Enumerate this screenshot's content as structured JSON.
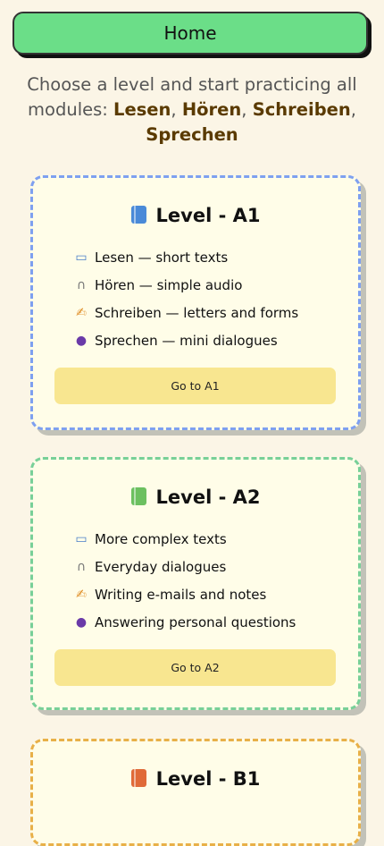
{
  "header": {
    "home_label": "Home"
  },
  "intro": {
    "prefix": "Choose a level and start practicing all modules: ",
    "modules": [
      "Lesen",
      "Hören",
      "Schreiben",
      "Sprechen"
    ],
    "sep1": ", ",
    "sep2": ", ",
    "sep3": ", "
  },
  "levels": [
    {
      "title": "Level - A1",
      "icon": "blue-book-icon",
      "color": "#7ea0f0",
      "items": [
        {
          "icon": "open-book-icon",
          "text": "Lesen — short texts"
        },
        {
          "icon": "headphones-icon",
          "text": "Hören — simple audio"
        },
        {
          "icon": "writing-hand-icon",
          "text": "Schreiben — letters and forms"
        },
        {
          "icon": "speaking-head-icon",
          "text": "Sprechen — mini dialogues"
        }
      ],
      "button": "Go to A1"
    },
    {
      "title": "Level - A2",
      "icon": "green-book-icon",
      "color": "#78d098",
      "items": [
        {
          "icon": "open-book-icon",
          "text": "More complex texts"
        },
        {
          "icon": "headphones-icon",
          "text": "Everyday dialogues"
        },
        {
          "icon": "writing-hand-icon",
          "text": "Writing e-mails and notes"
        },
        {
          "icon": "speaking-head-icon",
          "text": "Answering personal questions"
        }
      ],
      "button": "Go to A2"
    },
    {
      "title": "Level - B1",
      "icon": "orange-book-icon",
      "color": "#e8b048"
    }
  ]
}
